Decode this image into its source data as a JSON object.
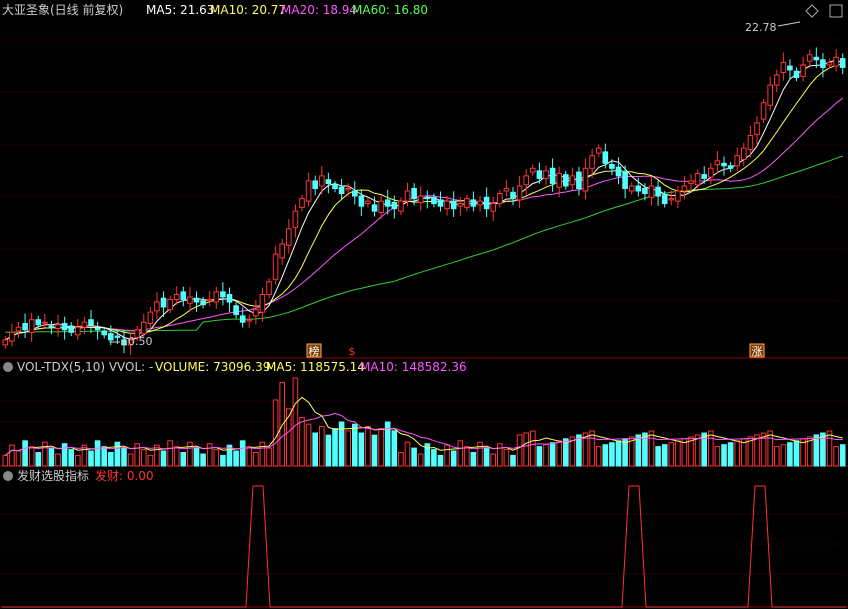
{
  "main": {
    "title": "大亚圣象(日线 前复权)",
    "ma_labels": [
      {
        "text": "MA5: 21.63",
        "color": "#ffffff"
      },
      {
        "text": "MA10: 20.77",
        "color": "#ffff55"
      },
      {
        "text": "MA20: 18.94",
        "color": "#ff55ff"
      },
      {
        "text": "MA60: 16.80",
        "color": "#55ff55"
      }
    ],
    "high_label": "22.78",
    "low_label": "10.50",
    "markers": [
      {
        "text": "榜",
        "type": "box",
        "index": 47
      },
      {
        "text": "$",
        "type": "plain",
        "index": 53
      },
      {
        "text": "涨",
        "type": "box",
        "index": 119
      }
    ]
  },
  "volume_panel": {
    "title": "VOL-TDX(5,10) VVOL: -",
    "labels": [
      {
        "text": "VOLUME: 73096.39",
        "color": "#ffff55"
      },
      {
        "text": "MA5: 118575.14",
        "color": "#ffff55"
      },
      {
        "text": "MA10: 148582.36",
        "color": "#ff55ff"
      }
    ]
  },
  "indicator_panel": {
    "title": "发财选股指标",
    "label": "发财: 0.00",
    "label_color": "#ff3333"
  },
  "colors": {
    "up": "#ff3333",
    "down": "#54ffff",
    "grid": "#7a0000",
    "ma5": "#ffffff",
    "ma10": "#ffff55",
    "ma20": "#ff55ff",
    "ma60": "#33cc33",
    "signal": "#ff3333"
  },
  "chart_data": {
    "type": "candlestick",
    "price_range": [
      10.2,
      23.4
    ],
    "closes": [
      10.8,
      11.1,
      11.3,
      11.2,
      11.6,
      11.4,
      11.5,
      11.3,
      11.4,
      11.2,
      11.1,
      11.3,
      11.5,
      11.4,
      11.2,
      11.0,
      10.8,
      10.9,
      10.6,
      10.8,
      11.2,
      11.5,
      11.9,
      12.3,
      12.1,
      12.4,
      12.6,
      12.4,
      12.5,
      12.3,
      12.2,
      12.4,
      12.7,
      12.5,
      12.3,
      11.8,
      11.5,
      11.6,
      12.0,
      12.6,
      13.1,
      14.2,
      14.6,
      15.2,
      15.9,
      16.4,
      17.1,
      16.8,
      17.3,
      17.0,
      16.8,
      16.6,
      16.8,
      16.5,
      16.1,
      16.3,
      15.9,
      16.3,
      16.1,
      16.0,
      16.3,
      16.7,
      16.4,
      16.5,
      16.4,
      16.2,
      16.1,
      16.3,
      16.0,
      16.2,
      16.4,
      16.1,
      16.3,
      16.0,
      16.2,
      16.6,
      16.8,
      16.4,
      16.9,
      17.3,
      17.6,
      17.2,
      17.5,
      17.0,
      17.4,
      16.9,
      17.3,
      16.8,
      17.6,
      18.1,
      18.4,
      17.8,
      17.6,
      17.3,
      16.8,
      16.9,
      16.7,
      16.6,
      16.9,
      16.5,
      16.2,
      16.4,
      16.7,
      16.9,
      17.1,
      17.4,
      17.2,
      17.6,
      17.9,
      17.7,
      17.6,
      18.1,
      18.4,
      18.9,
      19.4,
      20.2,
      20.9,
      21.3,
      21.8,
      21.5,
      21.2,
      21.7,
      22.1,
      21.9,
      21.6,
      21.8,
      22.0,
      21.6
    ],
    "main_ma_windows": [
      5,
      10,
      20,
      60
    ],
    "signal_indices": [
      61,
      150,
      180
    ],
    "volume_ma5": 118575.14,
    "volume_ma10": 148582.36,
    "volume_last": 73096.39,
    "indicator_value": 0.0
  }
}
